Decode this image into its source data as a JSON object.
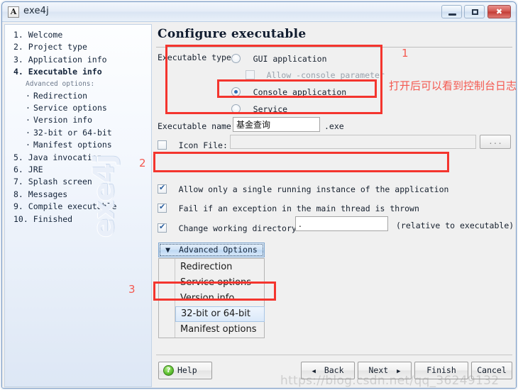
{
  "window": {
    "title": "exe4j",
    "app_icon": "A",
    "controls": {
      "minimize": "minimize-icon",
      "maximize": "maximize-icon",
      "close": "✖"
    }
  },
  "sidebar": {
    "steps": [
      {
        "num": "1.",
        "label": "Welcome",
        "active": false
      },
      {
        "num": "2.",
        "label": "Project type",
        "active": false
      },
      {
        "num": "3.",
        "label": "Application info",
        "active": false
      },
      {
        "num": "4.",
        "label": "Executable info",
        "active": true
      }
    ],
    "advanced_heading": "Advanced options:",
    "advanced_items": [
      "Redirection",
      "Service options",
      "Version info",
      "32-bit or 64-bit",
      "Manifest options"
    ],
    "steps_after": [
      {
        "num": "5.",
        "label": "Java invocation"
      },
      {
        "num": "6.",
        "label": "JRE"
      },
      {
        "num": "7.",
        "label": "Splash screen"
      },
      {
        "num": "8.",
        "label": "Messages"
      },
      {
        "num": "9.",
        "label": "Compile executable"
      },
      {
        "num": "10.",
        "label": "Finished"
      }
    ],
    "watermark": "exe4j"
  },
  "main": {
    "page_title": "Configure executable",
    "executable_type": {
      "label": "Executable type:",
      "options": [
        {
          "label": "GUI application",
          "selected": false
        },
        {
          "label": "Console application",
          "selected": true
        },
        {
          "label": "Service",
          "selected": false
        }
      ],
      "console_param": {
        "label": "Allow -console parameter",
        "checked": false,
        "enabled": false
      }
    },
    "executable_name": {
      "label": "Executable name:",
      "value": "基金查询",
      "suffix": ".exe"
    },
    "icon_file": {
      "label": "Icon File:",
      "checked": false,
      "value": "",
      "browse_label": "..."
    },
    "checkboxes": [
      {
        "label": "Allow only a single running instance of the application",
        "checked": true
      },
      {
        "label": "Fail if an exception in the main thread is thrown",
        "checked": true
      }
    ],
    "working_dir": {
      "label": "Change working directory to:",
      "checked": true,
      "value": ".",
      "hint": "(relative to executable)"
    },
    "advanced_options": {
      "button_label": "Advanced Options",
      "arrow": "▼",
      "items": [
        {
          "label": "Redirection",
          "selected": false
        },
        {
          "label": "Service options",
          "selected": false
        },
        {
          "label": "Version info",
          "selected": false
        },
        {
          "label": "32-bit or 64-bit",
          "selected": true
        },
        {
          "label": "Manifest options",
          "selected": false
        }
      ]
    },
    "footer": {
      "help": "Help",
      "back": "Back",
      "next": "Next",
      "finish": "Finish",
      "cancel": "Cancel",
      "back_arrow": "◀",
      "next_arrow": "▶"
    }
  },
  "annotations": {
    "num1": "1",
    "num2": "2",
    "num3": "3",
    "note_cn": "打开后可以看到控制台日志"
  },
  "watermark": "https://blog.csdn.net/qq_36249132",
  "colors": {
    "annotation_red": "#f4352e",
    "annotation_text_red": "#f4584f",
    "accent_blue": "#2f6fb5",
    "title_bar": "#e4ecf7"
  }
}
